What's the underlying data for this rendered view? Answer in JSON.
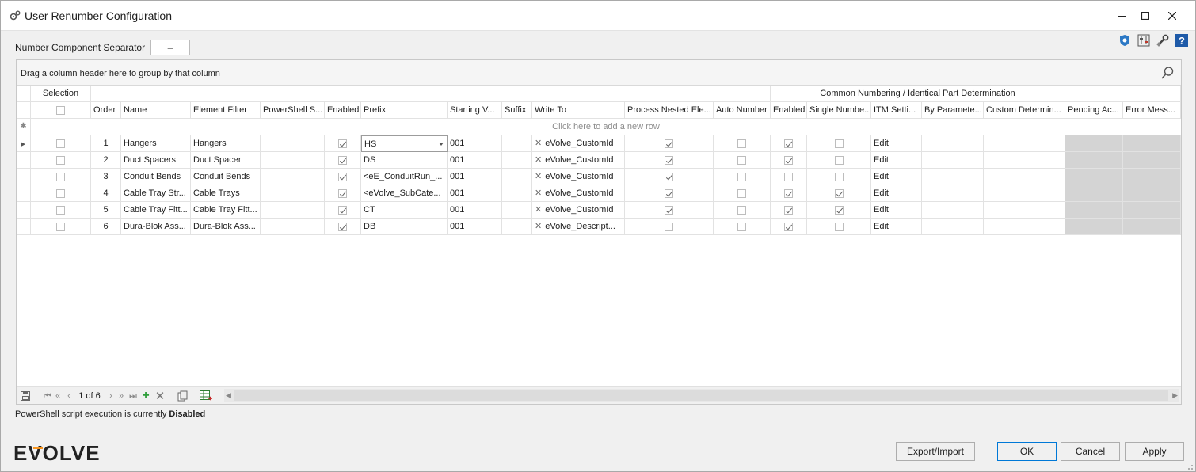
{
  "window": {
    "title": "User Renumber Configuration",
    "controls": [
      "minimize-icon",
      "maximize-icon",
      "close-icon"
    ]
  },
  "separator": {
    "label": "Number Component Separator",
    "value": "–"
  },
  "toolbar_icons": [
    "shield-icon",
    "settings-sliders-icon",
    "wrench-icon",
    "help-icon"
  ],
  "grid": {
    "group_panel_text": "Drag a column header here to group by that column",
    "bands": {
      "selection": "Selection",
      "common": "Common Numbering / Identical Part Determination"
    },
    "columns": [
      "Order",
      "Name",
      "Element Filter",
      "PowerShell S...",
      "Enabled",
      "Prefix",
      "Starting V...",
      "Suffix",
      "Write To",
      "Process Nested Ele...",
      "Auto Number",
      "Enabled",
      "Single Numbe...",
      "ITM Setti...",
      "By Paramete...",
      "Custom Determin...",
      "Pending Ac...",
      "Error Mess..."
    ],
    "new_row_text": "Click here to add a new row",
    "rows": [
      {
        "selected": false,
        "order": "1",
        "name": "Hangers",
        "filter": "Hangers",
        "ps": "",
        "enabled": true,
        "prefix": "HS",
        "start": "001",
        "suffix": "",
        "write_to": "eVolve_CustomId",
        "nested": true,
        "auto": false,
        "c_enabled": true,
        "single": false,
        "itm": "Edit"
      },
      {
        "selected": false,
        "order": "2",
        "name": "Duct Spacers",
        "filter": "Duct Spacer",
        "ps": "",
        "enabled": true,
        "prefix": "DS",
        "start": "001",
        "suffix": "",
        "write_to": "eVolve_CustomId",
        "nested": true,
        "auto": false,
        "c_enabled": true,
        "single": false,
        "itm": "Edit"
      },
      {
        "selected": false,
        "order": "3",
        "name": "Conduit Bends",
        "filter": "Conduit Bends",
        "ps": "",
        "enabled": true,
        "prefix": "<eE_ConduitRun_...",
        "start": "001",
        "suffix": "",
        "write_to": "eVolve_CustomId",
        "nested": true,
        "auto": false,
        "c_enabled": false,
        "single": false,
        "itm": "Edit"
      },
      {
        "selected": false,
        "order": "4",
        "name": "Cable Tray Str...",
        "filter": "Cable Trays",
        "ps": "",
        "enabled": true,
        "prefix": "<eVolve_SubCate...",
        "start": "001",
        "suffix": "",
        "write_to": "eVolve_CustomId",
        "nested": true,
        "auto": false,
        "c_enabled": true,
        "single": true,
        "itm": "Edit"
      },
      {
        "selected": false,
        "order": "5",
        "name": "Cable Tray Fitt...",
        "filter": "Cable Tray Fitt...",
        "ps": "",
        "enabled": true,
        "prefix": "CT",
        "start": "001",
        "suffix": "",
        "write_to": "eVolve_CustomId",
        "nested": true,
        "auto": false,
        "c_enabled": true,
        "single": true,
        "itm": "Edit"
      },
      {
        "selected": false,
        "order": "6",
        "name": "Dura-Blok Ass...",
        "filter": "Dura-Blok Ass...",
        "ps": "",
        "enabled": true,
        "prefix": "DB",
        "start": "001",
        "suffix": "",
        "write_to": "eVolve_Descript...",
        "nested": false,
        "auto": false,
        "c_enabled": true,
        "single": false,
        "itm": "Edit"
      }
    ],
    "navigator": {
      "record_text": "1 of 6"
    }
  },
  "status": {
    "prefix": "PowerShell script execution is currently ",
    "state": "Disabled"
  },
  "logo_text": "EVOLVE",
  "buttons": {
    "export_import": "Export/Import",
    "ok": "OK",
    "cancel": "Cancel",
    "apply": "Apply"
  },
  "colors": {
    "accent": "#0078d7",
    "logo_accent": "#f7941d",
    "disabled_cell": "#d4d4d4"
  }
}
